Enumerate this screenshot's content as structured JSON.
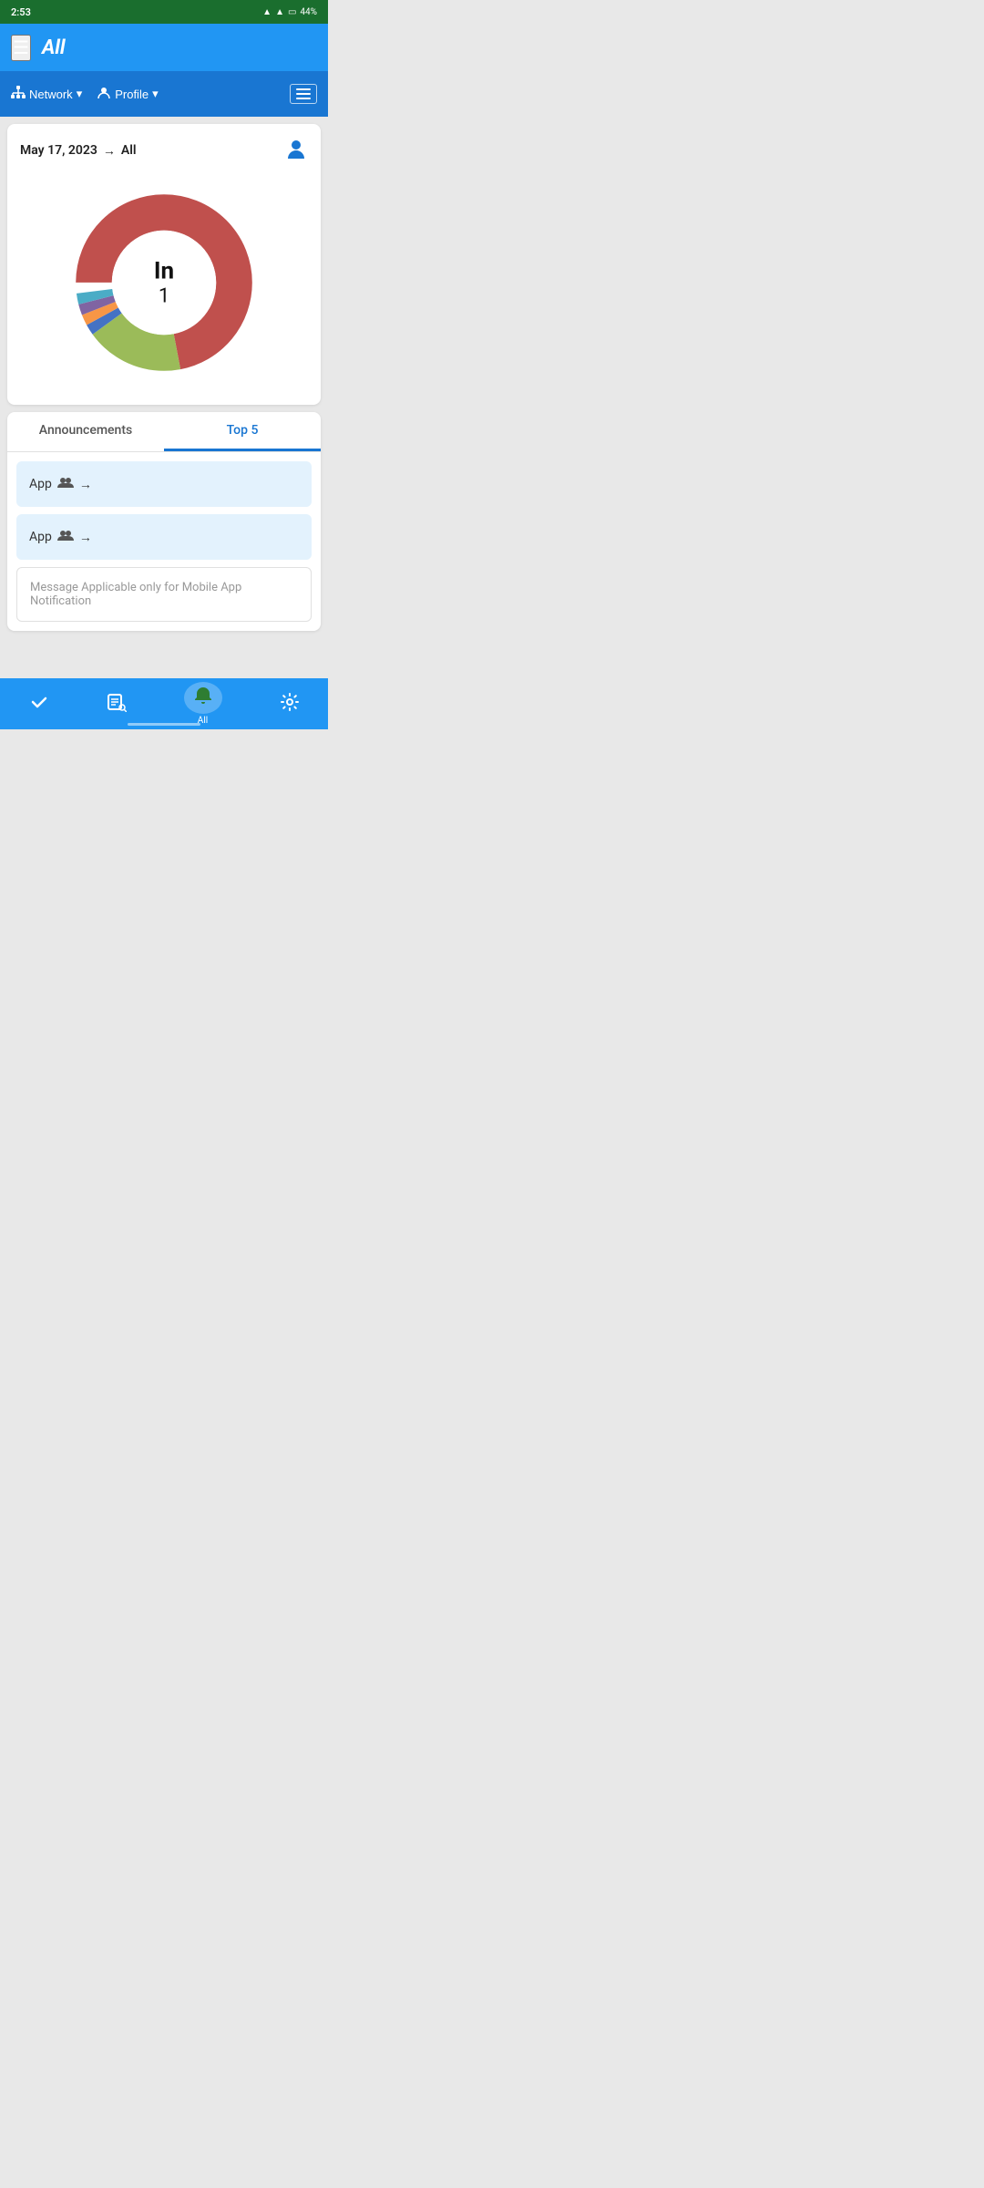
{
  "status": {
    "time": "2:53",
    "battery": "44%",
    "wifi": true,
    "signal": true
  },
  "app_bar": {
    "title": "All",
    "hamburger_label": "☰"
  },
  "sub_header": {
    "network_button": "Network",
    "profile_button": "Profile",
    "menu_button": "menu"
  },
  "chart_card": {
    "date": "May 17, 2023",
    "arrow": "→",
    "scope": "All",
    "center_label": "In",
    "center_value": "1",
    "segments": [
      {
        "color": "#c0504d",
        "percent": 72
      },
      {
        "color": "#9bbb59",
        "percent": 18
      },
      {
        "color": "#4472c4",
        "percent": 2
      },
      {
        "color": "#f79646",
        "percent": 2
      },
      {
        "color": "#8064a2",
        "percent": 2
      },
      {
        "color": "#4bacc6",
        "percent": 2
      },
      {
        "color": "#f0e68c",
        "percent": 2
      }
    ]
  },
  "tabs": {
    "items": [
      {
        "label": "Announcements",
        "active": false
      },
      {
        "label": "Top 5",
        "active": true
      }
    ]
  },
  "app_rows": [
    {
      "label": "App",
      "icon": "👥",
      "arrow": "→"
    },
    {
      "label": "App",
      "icon": "👥",
      "arrow": "→"
    }
  ],
  "message_box": {
    "placeholder": "Message Applicable only for Mobile App Notification"
  },
  "bottom_nav": {
    "items": [
      {
        "icon": "✔",
        "label": "",
        "name": "check"
      },
      {
        "icon": "🔍",
        "label": "",
        "name": "search"
      },
      {
        "icon": "🔔",
        "label": "All",
        "name": "notifications",
        "active": true
      },
      {
        "icon": "⚙",
        "label": "",
        "name": "settings"
      }
    ]
  }
}
